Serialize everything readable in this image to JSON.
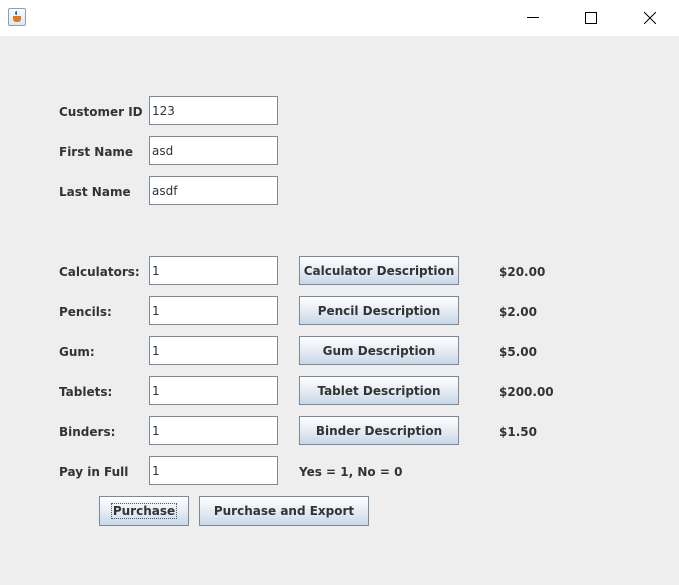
{
  "window": {
    "app_icon": "java-icon",
    "controls": [
      "minimize-icon",
      "maximize-icon",
      "close-icon"
    ]
  },
  "customer": {
    "id_label": "Customer ID",
    "id_value": "123",
    "first_name_label": "First Name",
    "first_name_value": "asd",
    "last_name_label": "Last Name",
    "last_name_value": "asdf"
  },
  "products": [
    {
      "label": "Calculators:",
      "quantity": "1",
      "button": "Calculator Description",
      "price": "$20.00"
    },
    {
      "label": "Pencils:",
      "quantity": "1",
      "button": "Pencil Description",
      "price": "$2.00"
    },
    {
      "label": "Gum:",
      "quantity": "1",
      "button": "Gum Description",
      "price": "$5.00"
    },
    {
      "label": "Tablets:",
      "quantity": "1",
      "button": "Tablet Description",
      "price": "$200.00"
    },
    {
      "label": "Binders:",
      "quantity": "1",
      "button": "Binder Description",
      "price": "$1.50"
    }
  ],
  "pay_in_full": {
    "label": "Pay in Full",
    "value": "1",
    "hint": "Yes = 1, No = 0"
  },
  "actions": {
    "purchase": "Purchase",
    "purchase_export": "Purchase and Export"
  },
  "colors": {
    "background": "#eeeeee",
    "button_gradient_bottom": "#c9d7e8",
    "field_border": "#7a8a99"
  }
}
